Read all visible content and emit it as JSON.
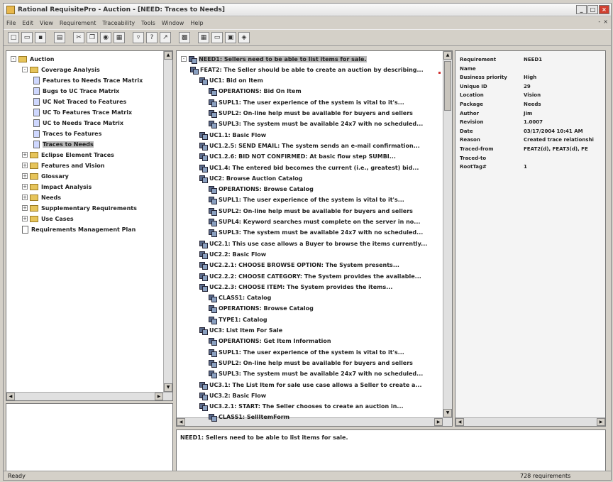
{
  "window": {
    "title": "Rational RequisitePro - Auction - [NEED: Traces to Needs]"
  },
  "menu": [
    "File",
    "Edit",
    "View",
    "Requirement",
    "Traceability",
    "Tools",
    "Window",
    "Help"
  ],
  "mdi_controls": [
    "-",
    "×"
  ],
  "left_tree": [
    {
      "label": "Auction",
      "level": 0,
      "icon": "folder-icon",
      "expander": "-"
    },
    {
      "label": "Coverage Analysis",
      "level": 1,
      "icon": "folder-icon",
      "expander": "-"
    },
    {
      "label": "Features  to Needs Trace Matrix",
      "level": 2,
      "icon": "view-icon"
    },
    {
      "label": "Bugs to UC Trace Matrix",
      "level": 2,
      "icon": "view-icon"
    },
    {
      "label": "UC Not Traced to Features",
      "level": 2,
      "icon": "view-icon"
    },
    {
      "label": "UC To Features Trace Matrix",
      "level": 2,
      "icon": "view-icon"
    },
    {
      "label": "UC to Needs Trace Matrix",
      "level": 2,
      "icon": "view-icon"
    },
    {
      "label": "Traces to Features",
      "level": 2,
      "icon": "view-icon"
    },
    {
      "label": "Traces to Needs",
      "level": 2,
      "icon": "view-icon",
      "selected": true
    },
    {
      "label": "Eclipse Element Traces",
      "level": 1,
      "icon": "folder-icon",
      "expander": "+"
    },
    {
      "label": "Features and Vision",
      "level": 1,
      "icon": "folder-icon",
      "expander": "+"
    },
    {
      "label": "Glossary",
      "level": 1,
      "icon": "folder-icon",
      "expander": "+"
    },
    {
      "label": "Impact Analysis",
      "level": 1,
      "icon": "folder-icon",
      "expander": "+"
    },
    {
      "label": "Needs",
      "level": 1,
      "icon": "folder-icon",
      "expander": "+"
    },
    {
      "label": "Supplementary Requirements",
      "level": 1,
      "icon": "folder-icon",
      "expander": "+"
    },
    {
      "label": "Use Cases",
      "level": 1,
      "icon": "folder-icon",
      "expander": "+"
    },
    {
      "label": "Requirements Management Plan",
      "level": 1,
      "icon": "doc-icon"
    }
  ],
  "main_tree": [
    {
      "label": "NEED1: Sellers need to be able to list items for sale.",
      "level": 0,
      "selected": true
    },
    {
      "label": "FEAT2: The Seller should be able to create an auction by describing...",
      "level": 1
    },
    {
      "label": "UC1: Bid on Item",
      "level": 2
    },
    {
      "label": "OPERATIONS: Bid On Item",
      "level": 3
    },
    {
      "label": "SUPL1: The user experience of the system is vital to it's...",
      "level": 3
    },
    {
      "label": "SUPL2: On-line help must be available for buyers and sellers",
      "level": 3
    },
    {
      "label": "SUPL3: The system must be available 24x7 with no scheduled...",
      "level": 3
    },
    {
      "label": "UC1.1: Basic Flow",
      "level": 2
    },
    {
      "label": "UC1.2.5: SEND EMAIL: The system sends an e-mail confirmation...",
      "level": 2
    },
    {
      "label": "UC1.2.6: BID NOT CONFIRMED: At basic flow step SUMBI...",
      "level": 2
    },
    {
      "label": "UC1.4: The entered bid becomes the current (i.e., greatest) bid...",
      "level": 2
    },
    {
      "label": "UC2: Browse Auction Catalog",
      "level": 2
    },
    {
      "label": "OPERATIONS: Browse Catalog",
      "level": 3
    },
    {
      "label": "SUPL1: The user experience of the system is vital to it's...",
      "level": 3
    },
    {
      "label": "SUPL2: On-line help must be available for buyers and sellers",
      "level": 3
    },
    {
      "label": "SUPL4: Keyword searches must complete on the server in no...",
      "level": 3
    },
    {
      "label": "SUPL3: The system must be available 24x7 with no scheduled...",
      "level": 3
    },
    {
      "label": "UC2.1: This use case allows a Buyer to browse the items currently...",
      "level": 2
    },
    {
      "label": "UC2.2: Basic Flow",
      "level": 2
    },
    {
      "label": "UC2.2.1: CHOOSE BROWSE OPTION: The System presents...",
      "level": 2
    },
    {
      "label": "UC2.2.2: CHOOSE CATEGORY: The System provides the available...",
      "level": 2
    },
    {
      "label": "UC2.2.3: CHOOSE ITEM: The System provides the items...",
      "level": 2
    },
    {
      "label": "CLASS1: Catalog",
      "level": 3
    },
    {
      "label": "OPERATIONS: Browse Catalog",
      "level": 3
    },
    {
      "label": "TYPE1: Catalog",
      "level": 3
    },
    {
      "label": "UC3: List Item For Sale",
      "level": 2
    },
    {
      "label": "OPERATIONS: Get Item Information",
      "level": 3
    },
    {
      "label": "SUPL1: The user experience of the system is vital to it's...",
      "level": 3
    },
    {
      "label": "SUPL2: On-line help must be available for buyers and sellers",
      "level": 3
    },
    {
      "label": "SUPL3: The system must be available 24x7 with no scheduled...",
      "level": 3
    },
    {
      "label": "UC3.1: The List Item for sale use case allows a Seller to create a...",
      "level": 2
    },
    {
      "label": "UC3.2: Basic Flow",
      "level": 2
    },
    {
      "label": "UC3.2.1: START:  The Seller chooses to create an auction in...",
      "level": 2
    },
    {
      "label": "CLASS1: SellItemForm",
      "level": 3
    }
  ],
  "properties": [
    {
      "key": "Requirement",
      "value": "NEED1"
    },
    {
      "key": "Name",
      "value": ""
    },
    {
      "key": "Business priority",
      "value": "High"
    },
    {
      "key": "Unique ID",
      "value": "29"
    },
    {
      "key": "Location",
      "value": "Vision"
    },
    {
      "key": "Package",
      "value": "Needs"
    },
    {
      "key": "Author",
      "value": "Jim"
    },
    {
      "key": "Revision",
      "value": "1.0007"
    },
    {
      "key": "Date",
      "value": "03/17/2004 10:41 AM"
    },
    {
      "key": "Reason",
      "value": "Created trace relationshi"
    },
    {
      "key": "Traced-from",
      "value": "FEAT2(d), FEAT3(d), FE"
    },
    {
      "key": "Traced-to",
      "value": ""
    },
    {
      "key": "RootTag#",
      "value": "1"
    }
  ],
  "description": "NEED1: Sellers need to be able to list items for sale.",
  "status": {
    "left": "Ready",
    "right": "728 requirements"
  }
}
